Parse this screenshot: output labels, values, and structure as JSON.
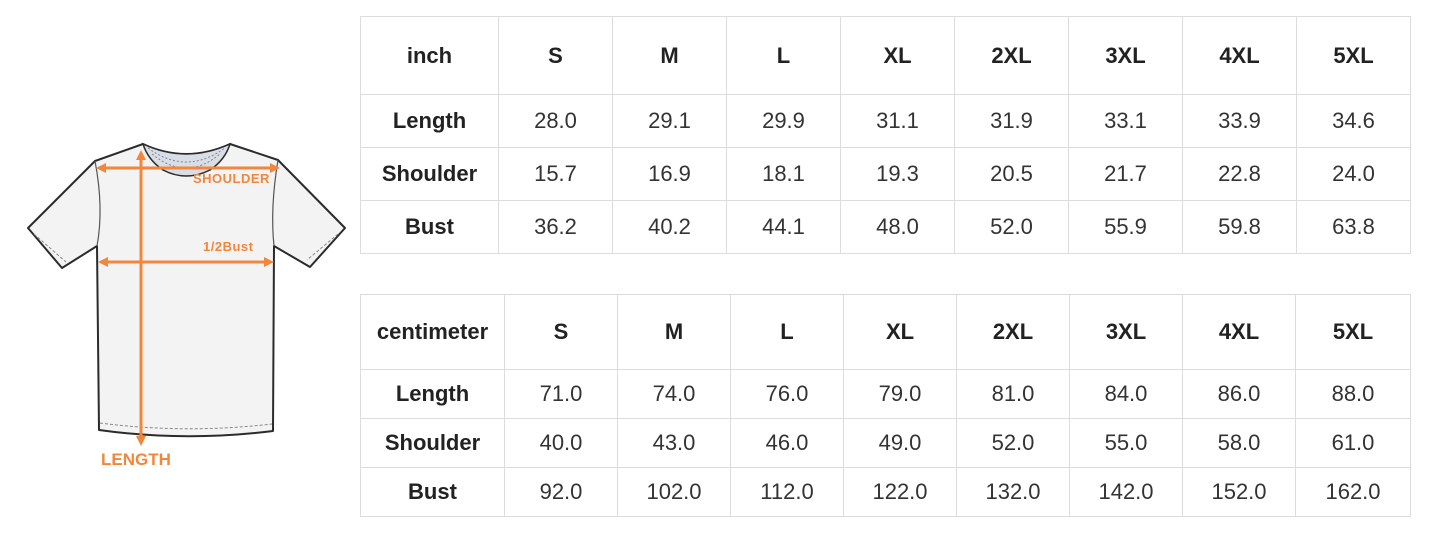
{
  "diagram": {
    "shoulder_label": "SHOULDER",
    "bust_label": "1/2Bust",
    "length_label": "LENGTH",
    "accent_color": "#f0873c"
  },
  "tables": {
    "inch": {
      "unit": "inch",
      "sizes": [
        "S",
        "M",
        "L",
        "XL",
        "2XL",
        "3XL",
        "4XL",
        "5XL"
      ],
      "rows": [
        {
          "label": "Length",
          "values": [
            "28.0",
            "29.1",
            "29.9",
            "31.1",
            "31.9",
            "33.1",
            "33.9",
            "34.6"
          ]
        },
        {
          "label": "Shoulder",
          "values": [
            "15.7",
            "16.9",
            "18.1",
            "19.3",
            "20.5",
            "21.7",
            "22.8",
            "24.0"
          ]
        },
        {
          "label": "Bust",
          "values": [
            "36.2",
            "40.2",
            "44.1",
            "48.0",
            "52.0",
            "55.9",
            "59.8",
            "63.8"
          ]
        }
      ]
    },
    "cm": {
      "unit": "centimeter",
      "sizes": [
        "S",
        "M",
        "L",
        "XL",
        "2XL",
        "3XL",
        "4XL",
        "5XL"
      ],
      "rows": [
        {
          "label": "Length",
          "values": [
            "71.0",
            "74.0",
            "76.0",
            "79.0",
            "81.0",
            "84.0",
            "86.0",
            "88.0"
          ]
        },
        {
          "label": "Shoulder",
          "values": [
            "40.0",
            "43.0",
            "46.0",
            "49.0",
            "52.0",
            "55.0",
            "58.0",
            "61.0"
          ]
        },
        {
          "label": "Bust",
          "values": [
            "92.0",
            "102.0",
            "112.0",
            "122.0",
            "132.0",
            "142.0",
            "152.0",
            "162.0"
          ]
        }
      ]
    }
  }
}
